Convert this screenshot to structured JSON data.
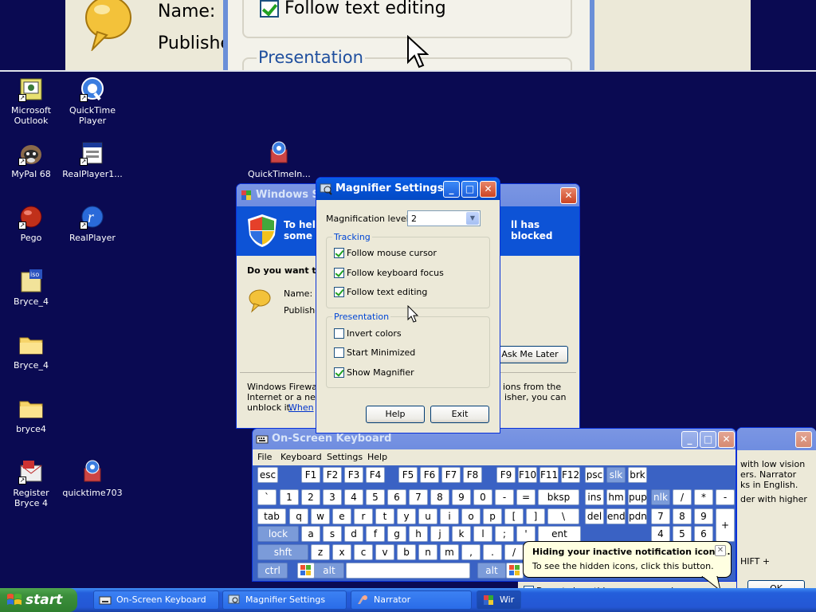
{
  "magnifier_view": {
    "name_label": "Name:",
    "publisher_label": "Publishe",
    "follow_text_editing": "Follow text editing",
    "presentation": "Presentation"
  },
  "desktop_icons": [
    {
      "label": "Microsoft Outlook",
      "icon": "outlook-icon"
    },
    {
      "label": "QuickTime Player",
      "icon": "quicktime-icon"
    },
    {
      "label": "MyPal 68",
      "icon": "mypal-icon"
    },
    {
      "label": "RealPlayer1...",
      "icon": "realplayer-installer-icon"
    },
    {
      "label": "QuickTimeIn...",
      "icon": "quicktime-installer-icon"
    },
    {
      "label": "Pego",
      "icon": "pego-icon"
    },
    {
      "label": "RealPlayer",
      "icon": "realplayer-icon"
    },
    {
      "label": "Bryce_4",
      "icon": "iso-file-icon"
    },
    {
      "label": "Bryce_4",
      "icon": "folder-icon"
    },
    {
      "label": "bryce4",
      "icon": "folder-icon"
    },
    {
      "label": "Register Bryce 4",
      "icon": "register-icon"
    },
    {
      "label": "quicktime703",
      "icon": "quicktime-installer-icon"
    }
  ],
  "security_window": {
    "title": "Windows Se",
    "banner_line1": "To help",
    "banner_line1_right": "ll has blocked",
    "banner_line2": "some fe",
    "question": "Do you want to",
    "name_label": "Name:",
    "publisher_label": "Publishe",
    "ask_later": "Ask Me Later",
    "footer_line1_left": "Windows Firewall",
    "footer_line1_right": "ions from the",
    "footer_line2_left": "Internet or a netw",
    "footer_line2_right": "isher, you can",
    "footer_line3_left": "unblock it.",
    "footer_link": "When"
  },
  "magnifier_settings": {
    "title": "Magnifier Settings",
    "level_label": "Magnification level:",
    "level_value": "2",
    "tracking_label": "Tracking",
    "tracking_items": [
      {
        "label": "Follow mouse cursor",
        "checked": true
      },
      {
        "label": "Follow keyboard focus",
        "checked": true
      },
      {
        "label": "Follow text editing",
        "checked": true
      }
    ],
    "presentation_label": "Presentation",
    "presentation_items": [
      {
        "label": "Invert colors",
        "checked": false
      },
      {
        "label": "Start Minimized",
        "checked": false
      },
      {
        "label": "Show Magnifier",
        "checked": true
      }
    ],
    "help_button": "Help",
    "exit_button": "Exit"
  },
  "osk": {
    "title": "On-Screen Keyboard",
    "menu": [
      "File",
      "Keyboard",
      "Settings",
      "Help"
    ],
    "row1": [
      "esc",
      "F1",
      "F2",
      "F3",
      "F4",
      "F5",
      "F6",
      "F7",
      "F8",
      "F9",
      "F10",
      "F11",
      "F12",
      "psc",
      "slk",
      "brk"
    ],
    "row2": [
      "`",
      "1",
      "2",
      "3",
      "4",
      "5",
      "6",
      "7",
      "8",
      "9",
      "0",
      "-",
      "=",
      "bksp",
      "ins",
      "hm",
      "pup",
      "nlk",
      "/",
      "*",
      "-"
    ],
    "row3": [
      "tab",
      "q",
      "w",
      "e",
      "r",
      "t",
      "y",
      "u",
      "i",
      "o",
      "p",
      "[",
      "]",
      "\\",
      "del",
      "end",
      "pdn",
      "7",
      "8",
      "9"
    ],
    "row4": [
      "lock",
      "a",
      "s",
      "d",
      "f",
      "g",
      "h",
      "j",
      "k",
      "l",
      ";",
      "'",
      "ent",
      "4",
      "5",
      "6"
    ],
    "row5": [
      "shft",
      "z",
      "x",
      "c",
      "v",
      "b",
      "n",
      "m",
      ",",
      ".",
      "/"
    ],
    "row6": [
      "ctrl",
      "alt",
      "alt"
    ],
    "plus": "+"
  },
  "narrator_window": {
    "line1": "with low vision",
    "line2": "ers. Narrator",
    "line3": "ks in English.",
    "line4": "der with higher",
    "line5": "HIFT +",
    "checkbox_label": "Do not show this message again",
    "ok_button": "OK"
  },
  "balloon": {
    "title": "Hiding your inactive notification icons...",
    "body": "To see the hidden icons, click this button."
  },
  "taskbar": {
    "start": "start",
    "items": [
      {
        "label": "On-Screen Keyboard"
      },
      {
        "label": "Magnifier Settings"
      },
      {
        "label": "Narrator"
      },
      {
        "label": "Wir"
      }
    ]
  },
  "colors": {
    "desktop": "#0a0a52",
    "xp_blue": "#0553d7",
    "start_green": "#3c8f3c",
    "osk_key_blue": "#7b9bd9"
  }
}
